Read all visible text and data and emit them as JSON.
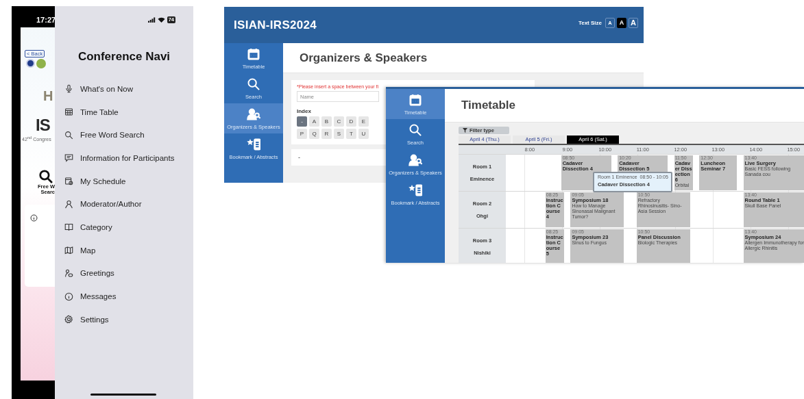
{
  "phone": {
    "time": "17:27",
    "battery": "74",
    "background_page": {
      "back": "< Back",
      "heading_letter": "H",
      "logo_text": "IS",
      "congress": "42$^{nd}$ Congres",
      "search_label": [
        "Free W",
        "Searc"
      ]
    },
    "drawer": {
      "title": "Conference Navi",
      "items": [
        {
          "label": "What's on Now"
        },
        {
          "label": "Time Table"
        },
        {
          "label": "Free Word Search"
        },
        {
          "label": "Information for Participants"
        },
        {
          "label": "My Schedule"
        },
        {
          "label": "Moderator/Author"
        },
        {
          "label": "Category"
        },
        {
          "label": "Map"
        },
        {
          "label": "Greetings"
        },
        {
          "label": "Messages"
        },
        {
          "label": "Settings"
        }
      ]
    }
  },
  "organizers_window": {
    "app_title": "ISIAN-IRS2024",
    "text_size": {
      "label": "Text Size",
      "options": [
        {
          "label": "A",
          "selected": false
        },
        {
          "label": "A",
          "selected": true
        },
        {
          "label": "A",
          "selected": false
        }
      ]
    },
    "sidebar": [
      {
        "label": "Timetable",
        "selected": false
      },
      {
        "label": "Search",
        "selected": false
      },
      {
        "label": "Organizers & Speakers",
        "selected": true
      },
      {
        "label": "Bookmark / Abstracts",
        "selected": false
      }
    ],
    "page_title": "Organizers & Speakers",
    "hint": "*Please insert a space between your fi",
    "name_placeholder": "Name",
    "index_label": "Index",
    "index_rows": [
      [
        {
          "label": "-",
          "selected": true
        },
        {
          "label": "A",
          "selected": false
        },
        {
          "label": "B",
          "selected": false
        },
        {
          "label": "C",
          "selected": false
        },
        {
          "label": "D",
          "selected": false
        },
        {
          "label": "E",
          "selected": false
        }
      ],
      [
        {
          "label": "P",
          "selected": false
        },
        {
          "label": "Q",
          "selected": false
        },
        {
          "label": "R",
          "selected": false
        },
        {
          "label": "S",
          "selected": false
        },
        {
          "label": "T",
          "selected": false
        },
        {
          "label": "U",
          "selected": false
        }
      ]
    ],
    "result_card": "-"
  },
  "timetable_window": {
    "sidebar": [
      {
        "label": "Timetable",
        "selected": true
      },
      {
        "label": "Search",
        "selected": false
      },
      {
        "label": "Organizers & Speakers",
        "selected": false
      },
      {
        "label": "Bookmark / Abstracts",
        "selected": false
      }
    ],
    "page_title": "Timetable",
    "filter": "Filter type",
    "days": [
      {
        "label": "April 4 (Thu.)",
        "selected": false
      },
      {
        "label": "April 5 (Fri.)",
        "selected": false
      },
      {
        "label": "April 6 (Sat.)",
        "selected": true
      }
    ],
    "hours": [
      "8:00",
      "9:00",
      "10:00",
      "11:00",
      "12:00",
      "13:00",
      "14:00",
      "15:00"
    ],
    "rooms": [
      {
        "name": "Room 1",
        "subname": "Eminence",
        "events": [
          {
            "start": "08:50",
            "title": "Cadaver Dissection 4"
          },
          {
            "start": "10:20",
            "title": "Cadaver Dissection 5"
          },
          {
            "start": "11:50",
            "title": "Cadaver Dissection 6",
            "subtitle": "Orbital"
          },
          {
            "start": "12:30",
            "title": "Luncheon Seminar 7"
          },
          {
            "start": "13:40",
            "title": "Live Surgery",
            "subtitle": "Basic FESS following Sanada cou"
          }
        ]
      },
      {
        "name": "Room 2",
        "subname": "Ohgi",
        "events": [
          {
            "start": "08:25",
            "title": "Instruction Course 4"
          },
          {
            "start": "09:05",
            "title": "Symposium 18",
            "subtitle": "How to Manage Sinonasal Malignant Tumor?"
          },
          {
            "start": "10:50",
            "subtitle": "Refractory Rhinosinusitis- Sino-Asia Session"
          },
          {
            "start": "13:40",
            "title": "Round Table 1",
            "subtitle": "Skull Base Panel"
          }
        ]
      },
      {
        "name": "Room 3",
        "subname": "Nishiki",
        "events": [
          {
            "start": "08:25",
            "title": "Instruction Course 5"
          },
          {
            "start": "09:05",
            "title": "Symposium 23",
            "subtitle": "Sinus to Fungus"
          },
          {
            "start": "10:50",
            "title": "Panel Discussion",
            "subtitle": "Biologic Therapies"
          },
          {
            "start": "13:40",
            "title": "Symposium 24",
            "subtitle": "Allergen Immunotherapy for Allergic Rhinitis"
          }
        ]
      }
    ],
    "tooltip": {
      "room": "Room 1 Eminence",
      "time": "08:50 - 10:05",
      "title": "Cadaver Dissection 4"
    }
  }
}
